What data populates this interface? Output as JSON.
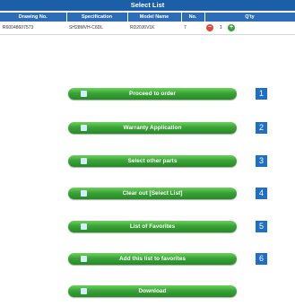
{
  "select_list": {
    "title": "Select List",
    "columns": [
      "Drawing No.",
      "Specification",
      "Model Name",
      "No.",
      "Q'ty"
    ],
    "rows": [
      {
        "drawing_no": "R60048607573",
        "specification": "SH28MVH-C6DL",
        "model_name": "RD20J6V1K",
        "no": "7",
        "qty": "1"
      }
    ]
  },
  "buttons": [
    {
      "label": "Proceed to order",
      "number": "1",
      "icon": "play-icon"
    },
    {
      "label": "Warranty Application",
      "number": "2",
      "icon": "document-icon"
    },
    {
      "label": "Select other parts",
      "number": "3",
      "icon": "search-icon"
    },
    {
      "label": "Clear out [Select List]",
      "number": "4",
      "icon": "clear-list-icon"
    },
    {
      "label": "List of Favorites",
      "number": "5",
      "icon": "favorites-list-icon"
    },
    {
      "label": "Add this list to favorites",
      "number": "6",
      "icon": "add-favorite-icon"
    },
    {
      "label": "Download",
      "number": "",
      "icon": "download-icon"
    }
  ],
  "colors": {
    "header_blue": "#1a5fa8",
    "button_green": "#3aa338",
    "number_badge_blue": "#1f6fc6"
  }
}
